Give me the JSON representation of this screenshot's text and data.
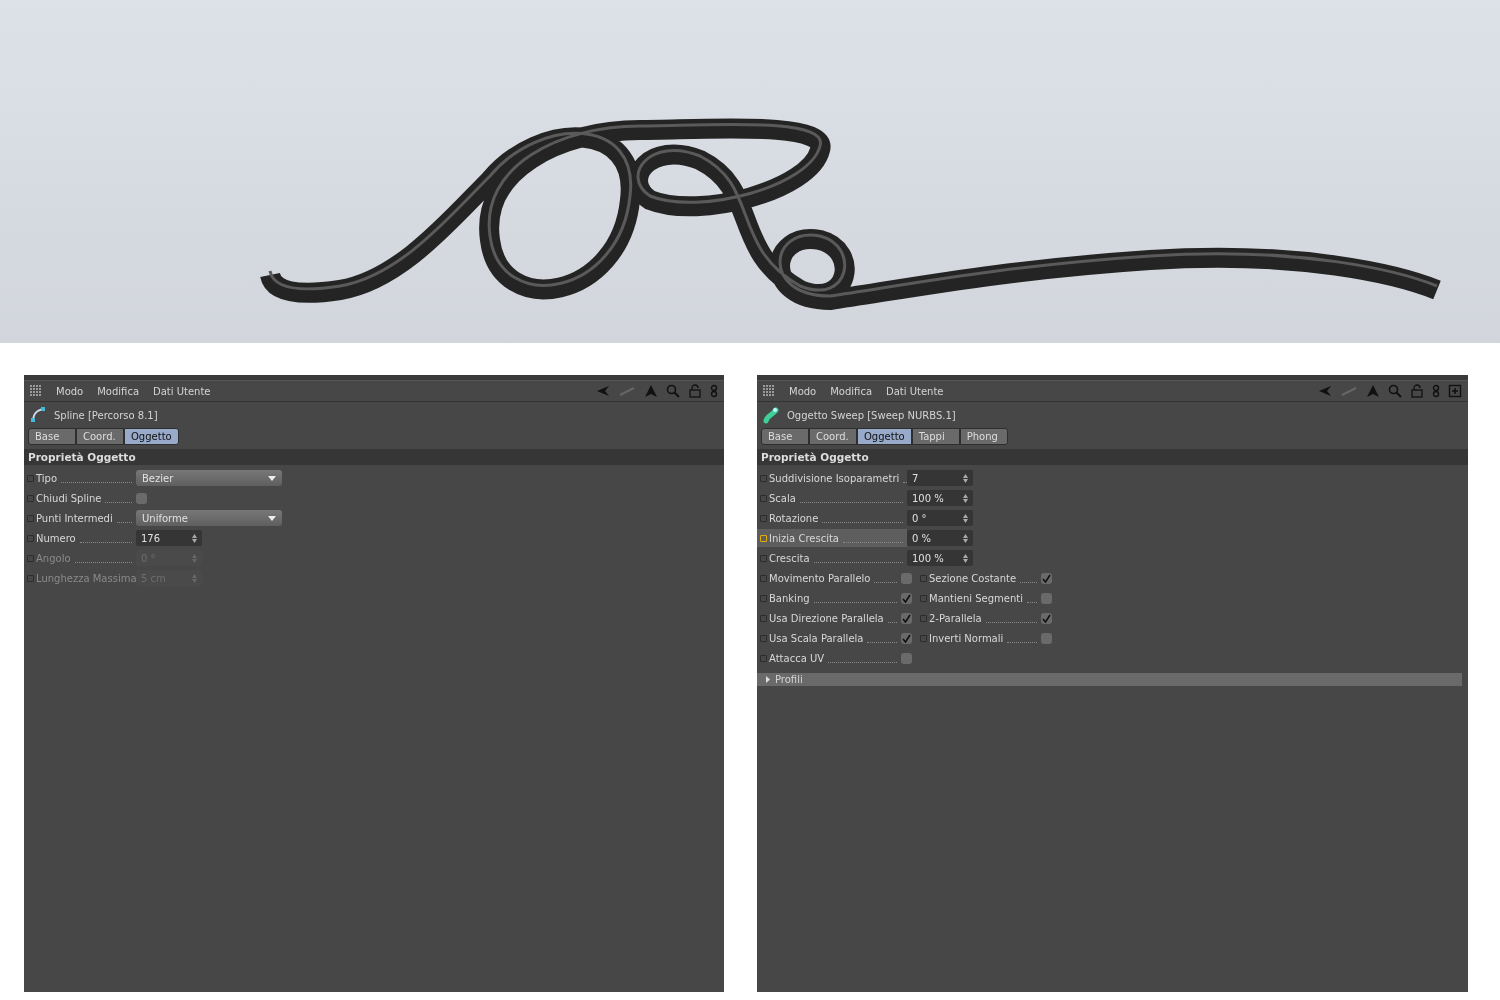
{
  "panels": [
    {
      "menu": [
        "Modo",
        "Modifica",
        "Dati Utente"
      ],
      "new_panel_button": false,
      "object": {
        "kind": "spline",
        "name": "Spline [Percorso 8.1]"
      },
      "tabs": [
        {
          "label": "Base",
          "selected": false
        },
        {
          "label": "Coord.",
          "selected": false
        },
        {
          "label": "Oggetto",
          "selected": true
        }
      ],
      "section": "Proprietà Oggetto",
      "fields": [
        {
          "kind": "dropdown",
          "label": "Tipo",
          "value": "Bezier",
          "disabled": false,
          "highlighted": false
        },
        {
          "kind": "checkbox",
          "label": "Chiudi Spline",
          "checked": false,
          "disabled": false,
          "highlighted": false
        },
        {
          "kind": "dropdown",
          "label": "Punti Intermedi",
          "value": "Uniforme",
          "disabled": false,
          "highlighted": false
        },
        {
          "kind": "number",
          "label": "Numero",
          "value": "176",
          "disabled": false,
          "highlighted": false
        },
        {
          "kind": "number",
          "label": "Angolo",
          "value": "0 °",
          "disabled": true,
          "highlighted": false
        },
        {
          "kind": "number",
          "label": "Lunghezza Massima",
          "value": "5 cm",
          "disabled": true,
          "highlighted": false
        }
      ]
    },
    {
      "menu": [
        "Modo",
        "Modifica",
        "Dati Utente"
      ],
      "new_panel_button": true,
      "object": {
        "kind": "sweep",
        "name": "Oggetto Sweep [Sweep NURBS.1]"
      },
      "tabs": [
        {
          "label": "Base",
          "selected": false
        },
        {
          "label": "Coord.",
          "selected": false
        },
        {
          "label": "Oggetto",
          "selected": true
        },
        {
          "label": "Tappi",
          "selected": false
        },
        {
          "label": "Phong",
          "selected": false
        }
      ],
      "section": "Proprietà Oggetto",
      "fields": [
        {
          "kind": "number",
          "label": "Suddivisione Isoparametri",
          "value": "7",
          "disabled": false,
          "highlighted": false
        },
        {
          "kind": "number",
          "label": "Scala",
          "value": "100 %",
          "disabled": false,
          "highlighted": false
        },
        {
          "kind": "number",
          "label": "Rotazione",
          "value": "0 °",
          "disabled": false,
          "highlighted": false
        },
        {
          "kind": "number",
          "label": "Inizia Crescita",
          "value": "0 %",
          "disabled": false,
          "highlighted": true
        },
        {
          "kind": "number",
          "label": "Crescita",
          "value": "100 %",
          "disabled": false,
          "highlighted": false
        }
      ],
      "checkbox_grid": [
        {
          "label": "Movimento Parallelo",
          "checked": false
        },
        {
          "label": "Sezione Costante",
          "checked": true
        },
        {
          "label": "Banking",
          "checked": true
        },
        {
          "label": "Mantieni Segmenti",
          "checked": false
        },
        {
          "label": "Usa Direzione Parallela",
          "checked": true
        },
        {
          "label": "2-Parallela",
          "checked": true
        },
        {
          "label": "Usa Scala Parallela",
          "checked": true
        },
        {
          "label": "Inverti Normali",
          "checked": false
        },
        {
          "label": "Attacca UV",
          "checked": false
        }
      ],
      "groups": [
        {
          "label": "Profili",
          "expanded": false
        }
      ]
    }
  ]
}
